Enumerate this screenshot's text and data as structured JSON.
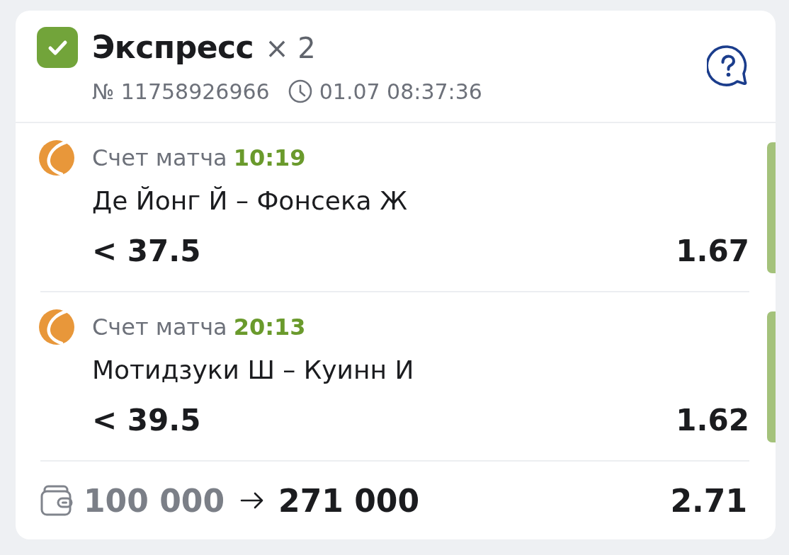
{
  "header": {
    "checked": true,
    "title": "Экспресс",
    "multiplier": "× 2",
    "number": "№ 11758926966",
    "datetime": "01.07 08:37:36"
  },
  "legs": [
    {
      "market": "Счет матча",
      "score": "10:19",
      "teams": "Де Йонг Й – Фонсека Ж",
      "selection": "< 37.5",
      "odds": "1.67",
      "won": true
    },
    {
      "market": "Счет матча",
      "score": "20:13",
      "teams": "Мотидзуки Ш – Куинн И",
      "selection": "< 39.5",
      "odds": "1.62",
      "won": true
    }
  ],
  "footer": {
    "stake": "100 000",
    "payout": "271 000",
    "total_odds": "2.71"
  }
}
